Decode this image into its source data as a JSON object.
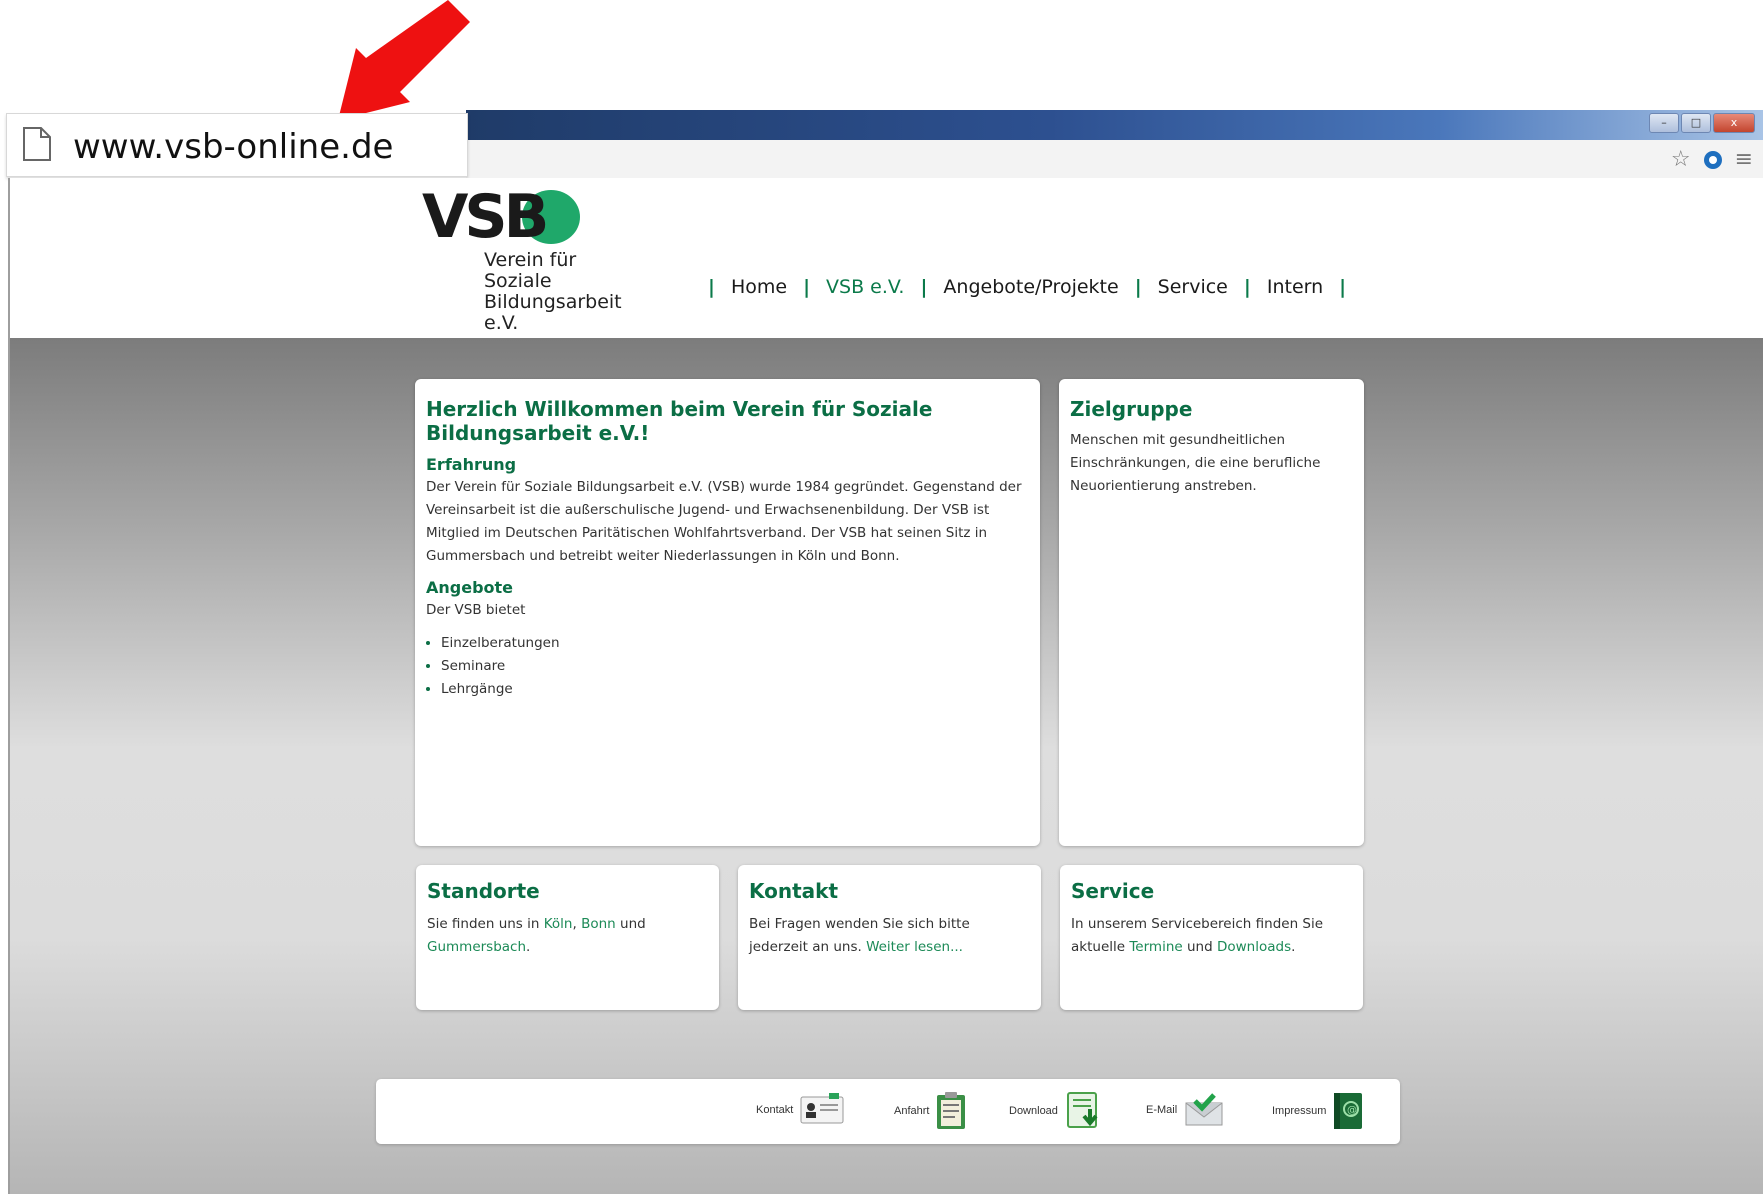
{
  "address_bar": {
    "url": "www.vsb-online.de"
  },
  "window_controls": {
    "minimize": "–",
    "maximize": "□",
    "close": "x"
  },
  "logo": {
    "wordmark": "VSB",
    "line1": "Verein für",
    "line2": "Soziale",
    "line3": "Bildungsarbeit e.V."
  },
  "nav": {
    "items": [
      "Home",
      "VSB e.V.",
      "Angebote/Projekte",
      "Service",
      "Intern"
    ],
    "separator": "|",
    "active_index": 1
  },
  "welcome": {
    "title": "Herzlich Willkommen beim Verein für Soziale Bildungsarbeit e.V.!",
    "erfahrung_heading": "Erfahrung",
    "erfahrung_text": "Der Verein für Soziale Bildungsarbeit e.V. (VSB) wurde 1984 gegründet. Gegenstand der Vereinsarbeit ist die außerschulische Jugend- und Erwachsenenbildung. Der VSB ist Mitglied im Deutschen Paritätischen Wohlfahrtsverband. Der VSB hat seinen Sitz in Gummersbach und betreibt weiter Niederlassungen in Köln und Bonn.",
    "angebote_heading": "Angebote",
    "angebote_intro": "Der VSB bietet",
    "angebote_list": [
      "Einzelberatungen",
      "Seminare",
      "Lehrgänge"
    ]
  },
  "zielgruppe": {
    "title": "Zielgruppe",
    "text": "Menschen mit gesundheitlichen Einschränkungen, die eine berufliche Neuorientierung anstreben."
  },
  "standorte": {
    "title": "Standorte",
    "text_a": "Sie finden uns in ",
    "link_koeln": "Köln",
    "sep1": ", ",
    "link_bonn": "Bonn",
    "text_b": " und ",
    "link_gummersbach": "Gummersbach",
    "text_c": "."
  },
  "kontakt": {
    "title": "Kontakt",
    "text": "Bei Fragen wenden Sie sich bitte jederzeit an uns. ",
    "link": "Weiter lesen..."
  },
  "service": {
    "title": "Service",
    "text_a": "In unserem Servicebereich finden Sie aktuelle ",
    "link_termine": "Termine",
    "text_b": " und ",
    "link_downloads": "Downloads",
    "text_c": "."
  },
  "footer": {
    "items": [
      "Kontakt",
      "Anfahrt",
      "Download",
      "E-Mail",
      "Impressum"
    ]
  },
  "colors": {
    "accent_green": "#0b6e45",
    "link_green": "#1c8a57",
    "logo_circle": "#1fa86a",
    "arrow_red": "#ee1111"
  }
}
